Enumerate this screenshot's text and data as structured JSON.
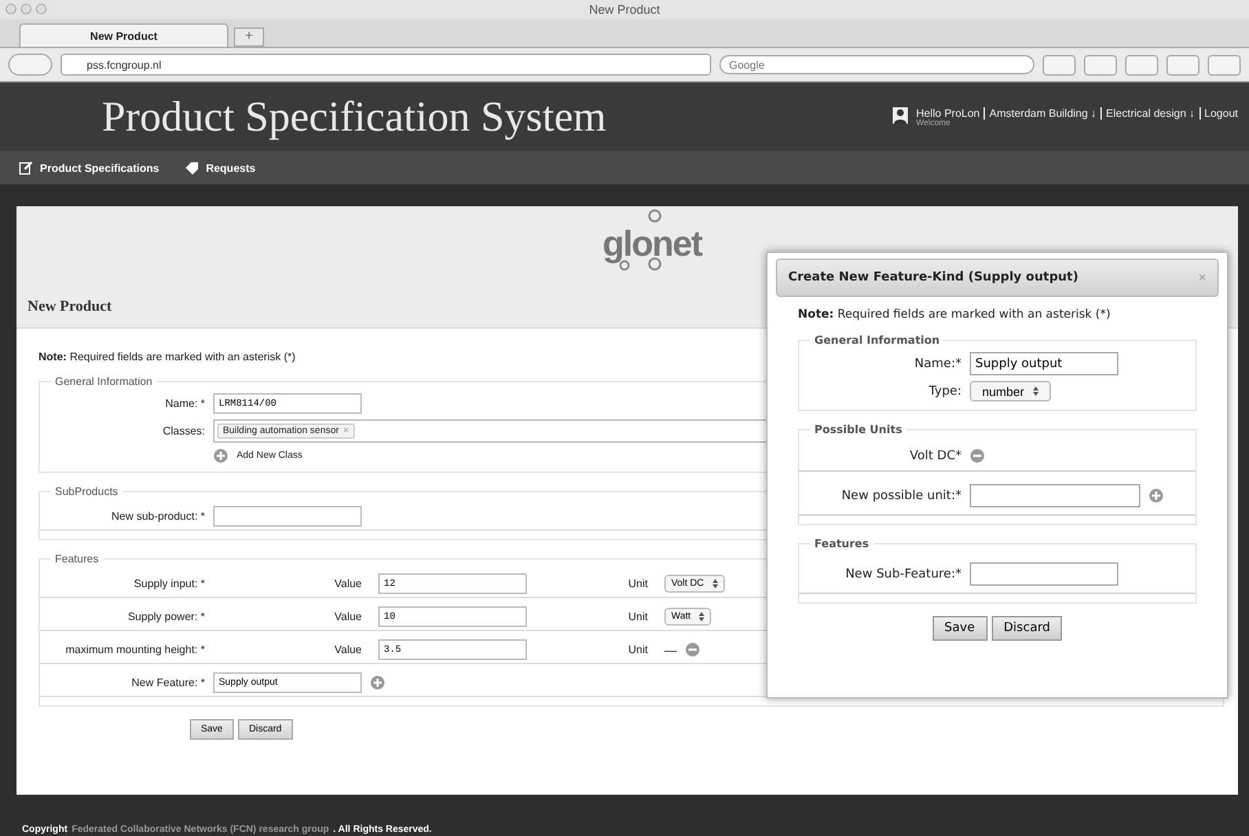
{
  "browser": {
    "window_title": "New Product",
    "tabs": [
      {
        "label": "New Product",
        "selected": true
      }
    ],
    "new_tab": "+",
    "address": "pss.fcngroup.nl",
    "search": {
      "placeholder": "Google"
    }
  },
  "header": {
    "title": "Product Specification System",
    "greeting": "Hello ProLon",
    "welcome": "Welcome",
    "links": [
      "Amsterdam Building ↓",
      "Electrical design ↓",
      "Logout"
    ]
  },
  "nav": [
    {
      "label": "Product Specifications",
      "kind": "edit"
    },
    {
      "label": "Requests",
      "kind": "tag"
    }
  ],
  "page": {
    "logo": "glonet",
    "title": "New Product",
    "note_bold": "Note:",
    "note": "Required fields are marked with an asterisk (*)",
    "general": {
      "legend": "General Information",
      "name_label": "Name: *",
      "name_value": "LRM8114/00",
      "classes_label": "Classes:",
      "classes": [
        {
          "label": "Building automation sensor",
          "remove": "×"
        }
      ],
      "add_class": "Add New Class"
    },
    "subproducts": {
      "legend": "SubProducts",
      "label": "New sub-product: *"
    },
    "features": {
      "legend": "Features",
      "rows": [
        {
          "label": "Supply input: *",
          "value_label": "Value",
          "value": "12",
          "unit_label": "Unit",
          "kind": "select",
          "unit": "Volt DC"
        },
        {
          "label": "Supply power: *",
          "value_label": "Value",
          "value": "10",
          "unit_label": "Unit",
          "kind": "select",
          "unit": "Watt"
        },
        {
          "label": "maximum mounting height: *",
          "value_label": "Value",
          "value": "3.5",
          "unit_label": "Unit",
          "kind": "none",
          "unit": "—"
        }
      ],
      "new_label": "New Feature: *",
      "new_value": "Supply output"
    },
    "buttons": [
      "Save",
      "Discard"
    ]
  },
  "dialog": {
    "title": "Create New Feature-Kind (Supply output)",
    "close": "×",
    "note_bold": "Note:",
    "note": "Required fields are marked with an asterisk (*)",
    "general": {
      "legend": "General Information",
      "name_label": "Name:*",
      "name_value": "Supply output",
      "type_label": "Type:",
      "type_value": "number"
    },
    "units": {
      "legend": "Possible Units",
      "items": [
        "Volt DC*"
      ],
      "new_label": "New possible unit:*"
    },
    "features": {
      "legend": "Features",
      "new_label": "New Sub-Feature:*"
    },
    "buttons": [
      "Save",
      "Discard"
    ]
  },
  "footer": {
    "prefix": "Copyright",
    "link": "Federated Collaborative Networks (FCN) research group",
    "suffix": ". All Rights Reserved."
  }
}
